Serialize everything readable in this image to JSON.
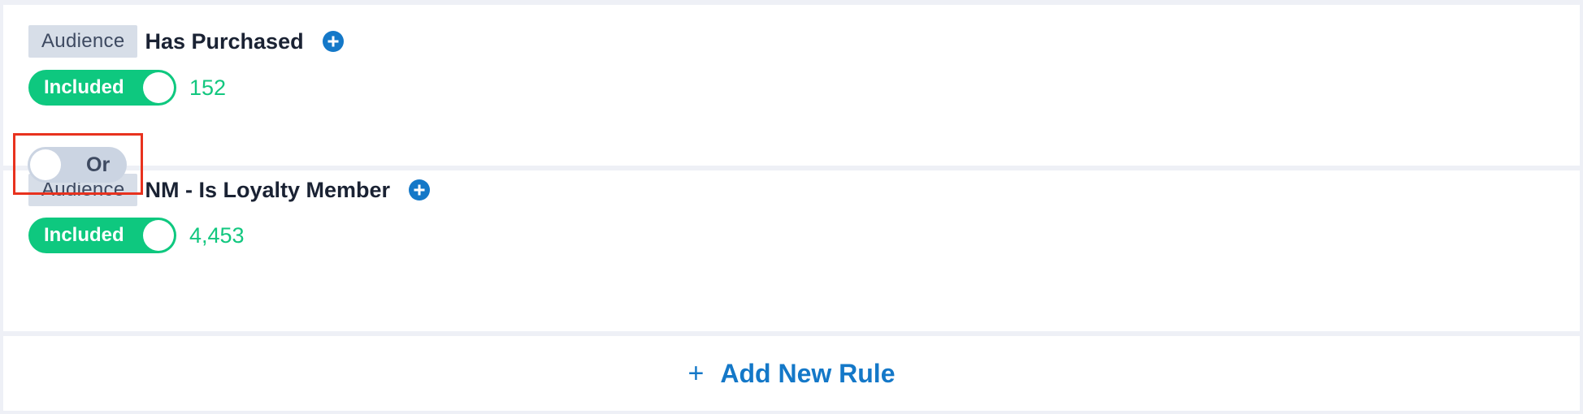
{
  "rules": [
    {
      "tag": "Audience",
      "name": "Has Purchased",
      "toggle_label": "Included",
      "count": "152"
    },
    {
      "tag": "Audience",
      "name": "NM - Is Loyalty Member",
      "toggle_label": "Included",
      "count": "4,453"
    }
  ],
  "connector": {
    "label": "Or",
    "highlight_color": "#e8321e"
  },
  "add_rule": {
    "icon": "+",
    "label": "Add New Rule"
  },
  "colors": {
    "included_green": "#0ec87f",
    "count_green": "#12c77f",
    "accent_blue": "#1478c8",
    "tag_bg": "#d7dee8"
  }
}
